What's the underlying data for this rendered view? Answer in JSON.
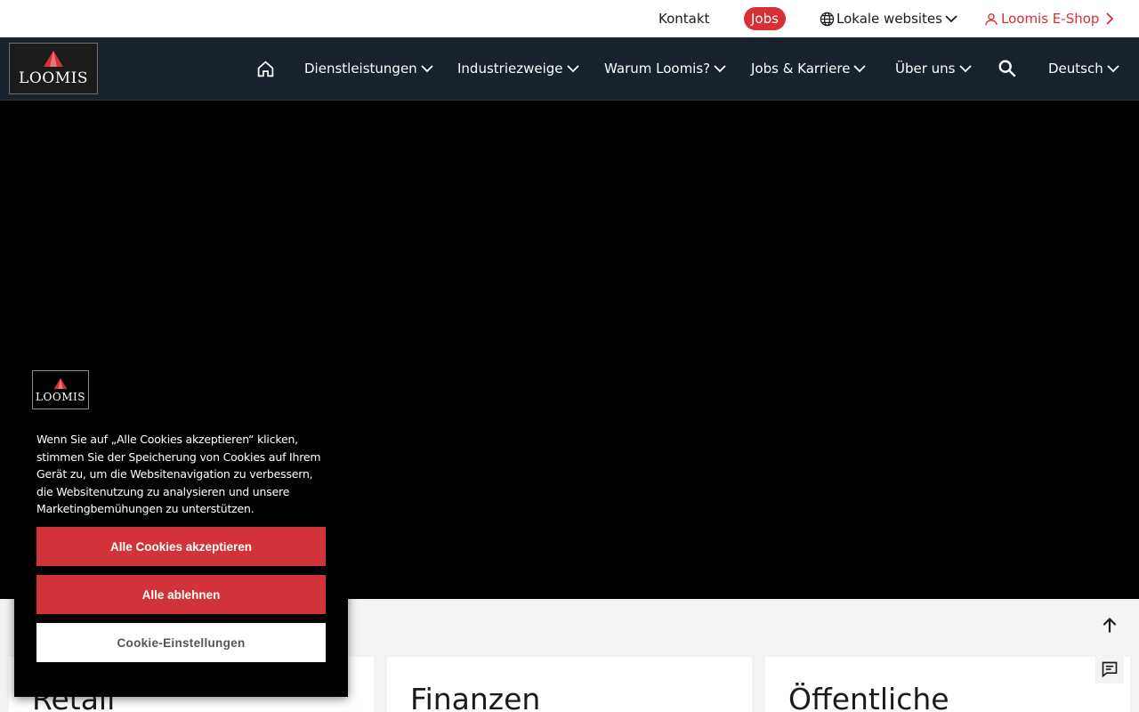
{
  "utility": {
    "kontakt": "Kontakt",
    "jobs": "Jobs",
    "local_websites": "Lokale websites",
    "eshop": "Loomis E-Shop"
  },
  "brand": {
    "logo_text": "LOOMIS",
    "accent": "#d62f35",
    "nav_bg": "#17222c"
  },
  "nav": {
    "items": [
      {
        "label": "Dienstleistungen"
      },
      {
        "label": "Industriezweige"
      },
      {
        "label": "Warum Loomis?"
      },
      {
        "label": "Jobs & Karriere"
      },
      {
        "label": "Über uns"
      }
    ],
    "language": "Deutsch"
  },
  "cards": [
    {
      "title": "Retail"
    },
    {
      "title": "Finanzen"
    },
    {
      "title": "Öffentliche"
    }
  ],
  "cookie": {
    "text": "Wenn Sie auf „Alle Cookies akzeptieren“ klicken, stimmen Sie der Speicherung von Cookies auf Ihrem Gerät zu, um die Websitenavigation zu verbessern, die Websitenutzung zu analysieren und unsere Marketingbemühungen zu unterstützen.",
    "accept_all": "Alle Cookies akzeptieren",
    "reject_all": "Alle ablehnen",
    "settings": "Cookie-Einstellungen"
  }
}
